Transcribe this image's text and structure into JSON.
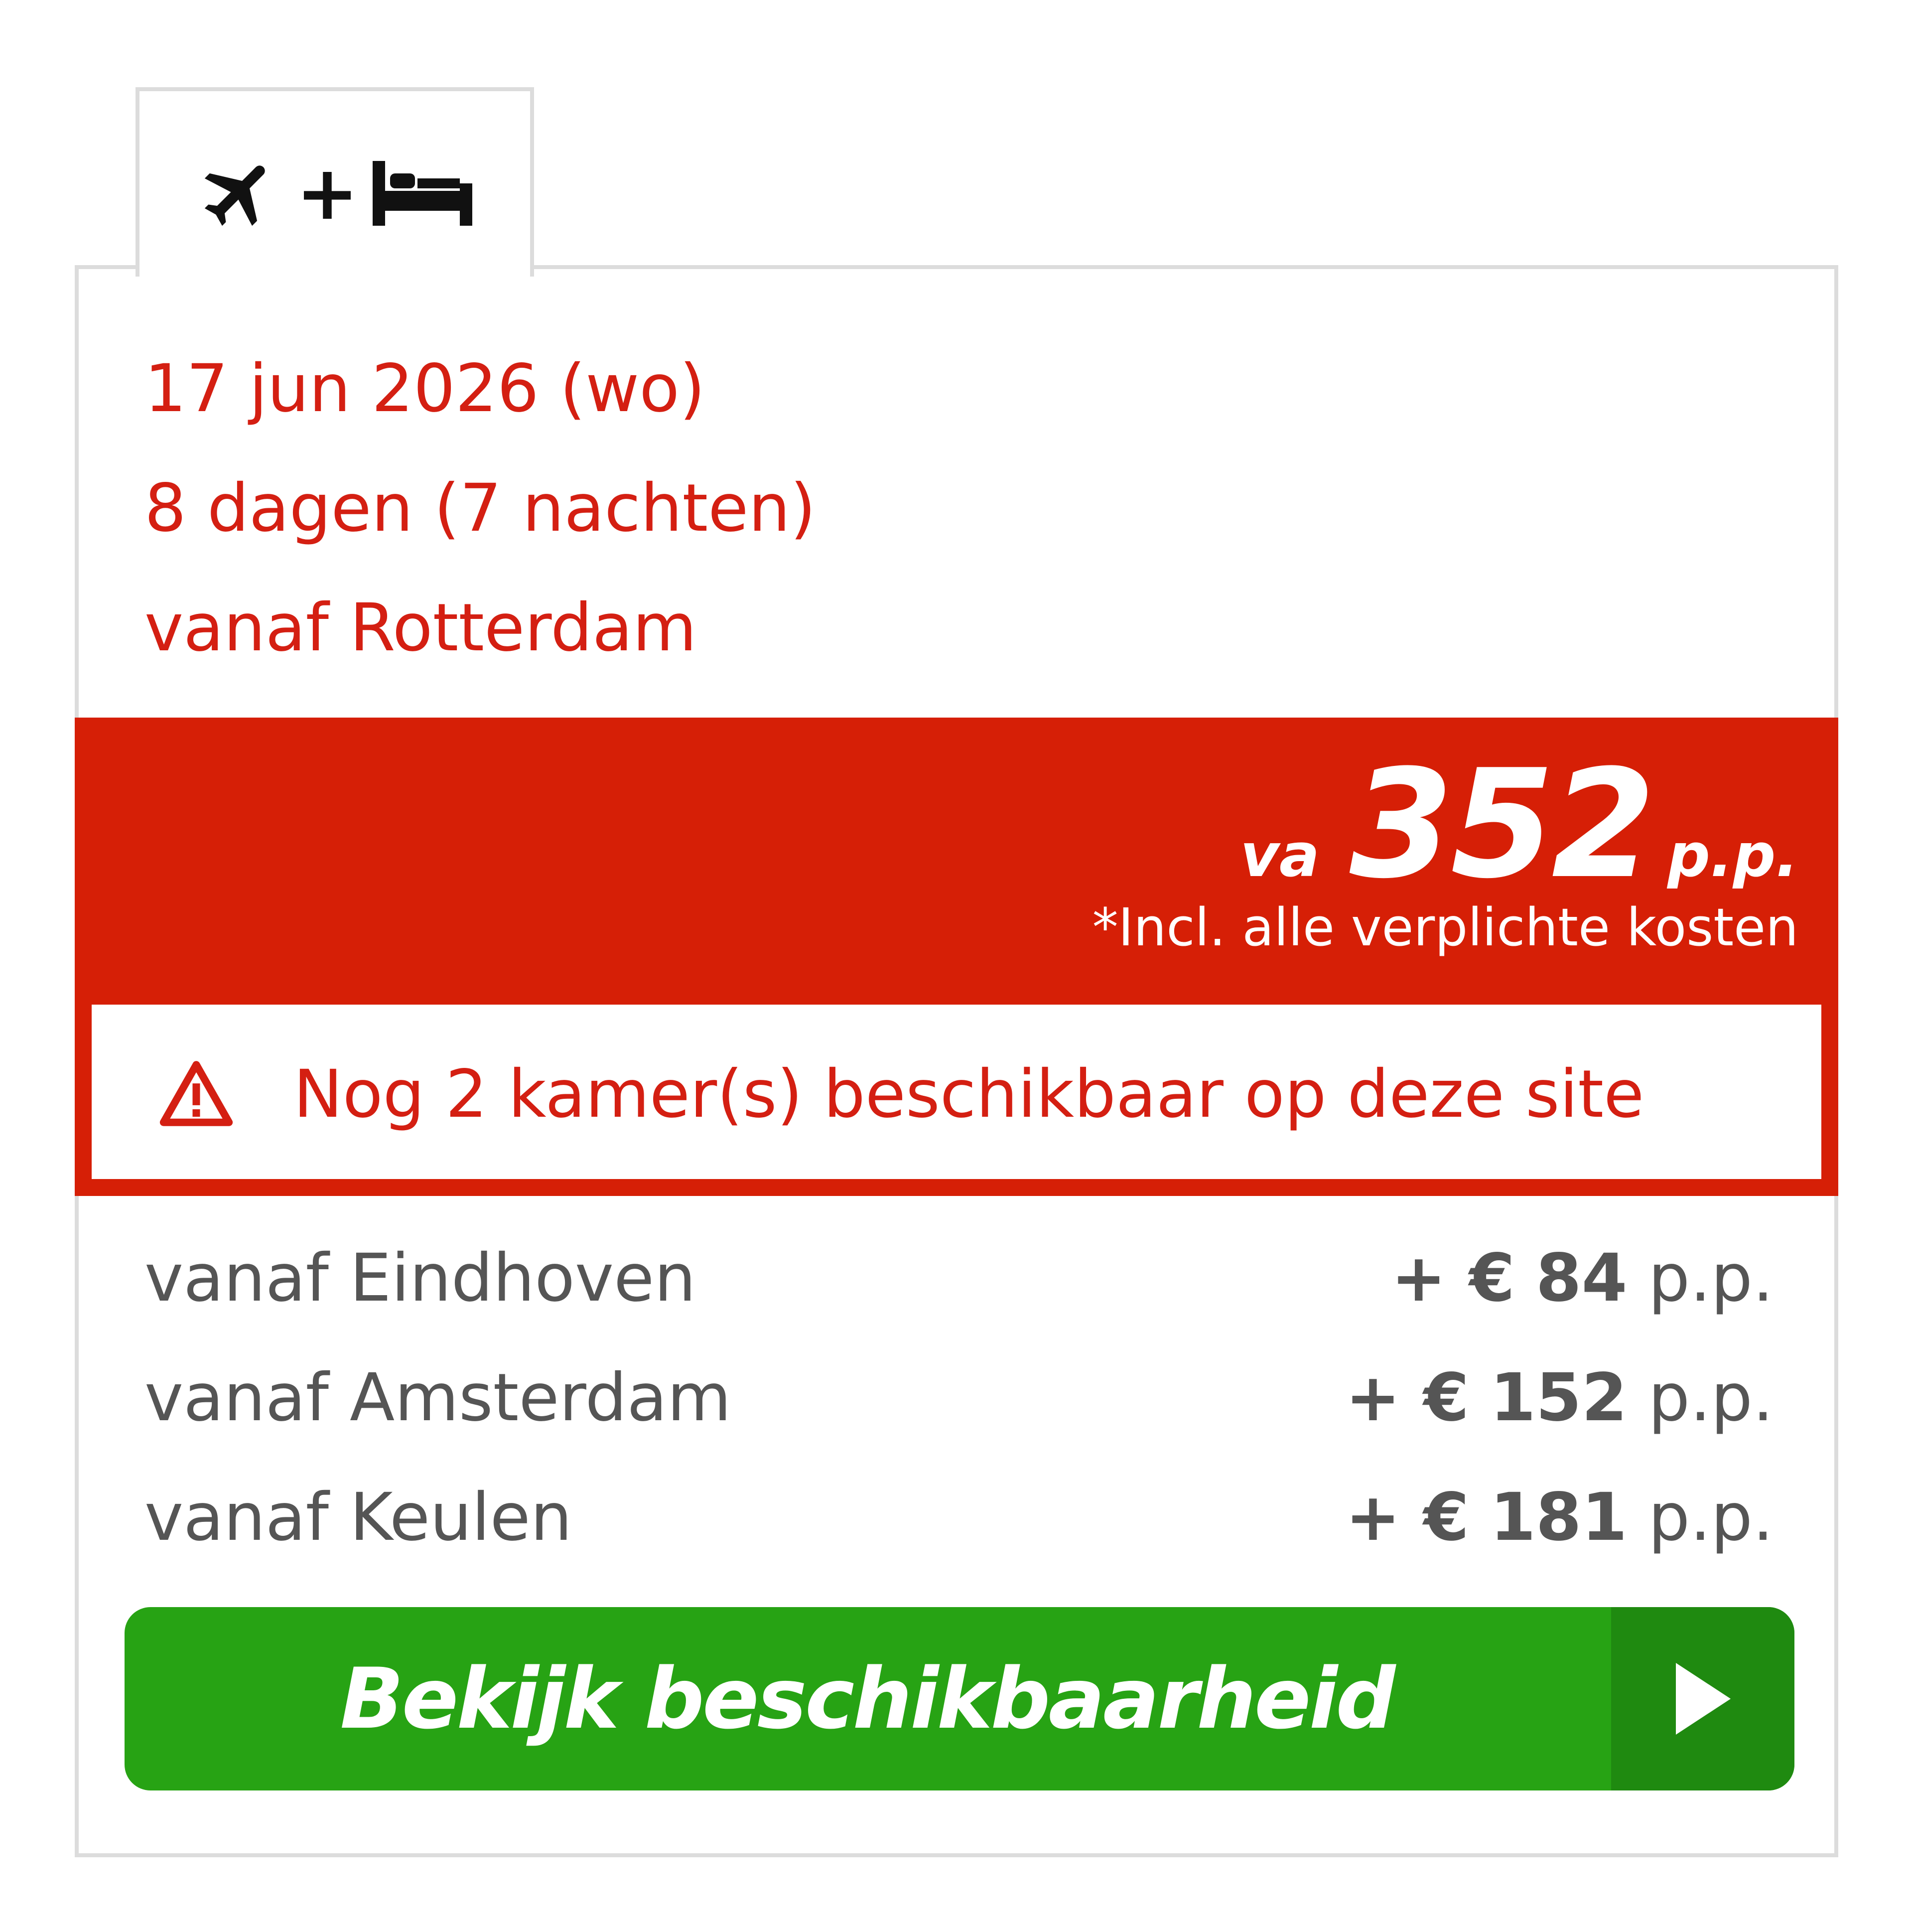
{
  "tab": {
    "icons": [
      "airplane-icon",
      "bed-icon"
    ],
    "plus": "+"
  },
  "trip": {
    "date": "17 jun 2026 (wo)",
    "duration": "8 dagen (7 nachten)",
    "departure": "vanaf Rotterdam"
  },
  "price": {
    "prefix": "va",
    "amount": "352",
    "suffix": "p.p.",
    "note": "*Incl. alle verplichte kosten"
  },
  "availability": {
    "icon": "warning-icon",
    "text": "Nog 2 kamer(s) beschikbaar op deze site"
  },
  "alternatives": [
    {
      "label": "vanaf Eindhoven",
      "prefix": "+ €",
      "amount": "84",
      "unit": "p.p."
    },
    {
      "label": "vanaf Amsterdam",
      "prefix": "+ €",
      "amount": "152",
      "unit": "p.p."
    },
    {
      "label": "vanaf Keulen",
      "prefix": "+ €",
      "amount": "181",
      "unit": "p.p."
    }
  ],
  "cta": {
    "label": "Bekijk beschikbaarheid",
    "icon": "play-arrow-icon"
  },
  "colors": {
    "accent_red": "#d61f06",
    "text_red": "#d41f12",
    "cta_green": "#27a314",
    "cta_green_dark": "#1f8a10",
    "border_gray": "#dcdcdc",
    "text_gray": "#555555"
  }
}
